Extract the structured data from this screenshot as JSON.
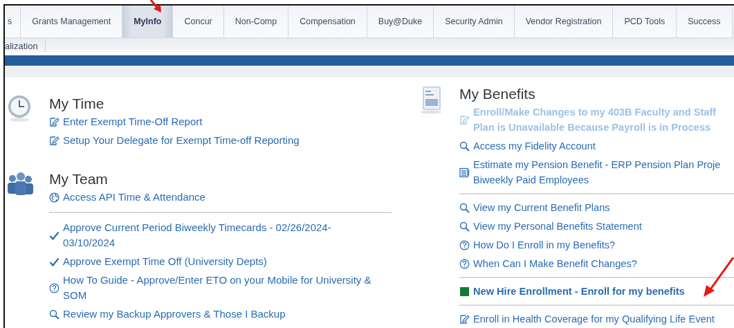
{
  "tabs": [
    {
      "label": "s",
      "selected": false
    },
    {
      "label": "Grants Management",
      "selected": false
    },
    {
      "label": "MyInfo",
      "selected": true
    },
    {
      "label": "Concur",
      "selected": false
    },
    {
      "label": "Non-Comp",
      "selected": false
    },
    {
      "label": "Compensation",
      "selected": false
    },
    {
      "label": "Buy@Duke",
      "selected": false
    },
    {
      "label": "Security Admin",
      "selected": false
    },
    {
      "label": "Vendor Registration",
      "selected": false
    },
    {
      "label": "PCD Tools",
      "selected": false
    },
    {
      "label": "Success",
      "selected": false
    }
  ],
  "subtabs": [
    {
      "label": "alization"
    }
  ],
  "columns": [
    {
      "sections": [
        {
          "title": "My Time",
          "kind": "clock",
          "groups": [
            [
              {
                "kind": "edit",
                "lines": [
                  "Enter Exempt Time-Off Report"
                ],
                "disabled": false,
                "bold": false
              },
              {
                "kind": "edit",
                "lines": [
                  "Setup Your Delegate for Exempt Time-off Reporting"
                ],
                "disabled": false,
                "bold": false
              }
            ]
          ]
        },
        {
          "title": "My Team",
          "kind": "team",
          "groups": [
            [
              {
                "kind": "globe",
                "lines": [
                  "Access API Time & Attendance"
                ],
                "disabled": false,
                "bold": false
              }
            ],
            [
              {
                "kind": "check",
                "lines": [
                  "Approve Current Period Biweekly Timecards - 02/26/2024-",
                  "03/10/2024"
                ],
                "disabled": false,
                "bold": false
              },
              {
                "kind": "check",
                "lines": [
                  "Approve Exempt Time Off (University Depts)"
                ],
                "disabled": false,
                "bold": false
              },
              {
                "kind": "help",
                "lines": [
                  "How To Guide - Approve/Enter ETO on your Mobile for University &",
                  "SOM"
                ],
                "disabled": false,
                "bold": false
              },
              {
                "kind": "search",
                "lines": [
                  "Review my Backup Approvers & Those I Backup"
                ],
                "disabled": false,
                "bold": false
              }
            ]
          ]
        }
      ]
    },
    {
      "sections": [
        {
          "title": "My Benefits",
          "kind": "document",
          "groups": [
            [
              {
                "kind": "edit",
                "lines": [
                  "Enroll/Make Changes to my 403B Faculty and Staff",
                  "Plan is Unavailable Because Payroll is in Process"
                ],
                "disabled": true,
                "bold": true
              },
              {
                "kind": "search",
                "lines": [
                  "Access my Fidelity Account"
                ],
                "disabled": false,
                "bold": false
              },
              {
                "kind": "list",
                "lines": [
                  "Estimate my Pension Benefit - ERP Pension Plan Proje",
                  "Biweekly Paid Employees"
                ],
                "disabled": false,
                "bold": false
              }
            ],
            [
              {
                "kind": "search",
                "lines": [
                  "View my Current Benefit Plans"
                ],
                "disabled": false,
                "bold": false
              },
              {
                "kind": "search",
                "lines": [
                  "View my Personal Benefits Statement"
                ],
                "disabled": false,
                "bold": false
              },
              {
                "kind": "help",
                "lines": [
                  "How Do I Enroll in my Benefits?"
                ],
                "disabled": false,
                "bold": false
              },
              {
                "kind": "help",
                "lines": [
                  "When Can I Make Benefit Changes?"
                ],
                "disabled": false,
                "bold": false
              }
            ],
            [
              {
                "kind": "square",
                "lines": [
                  "New Hire Enrollment - Enroll for my benefits"
                ],
                "disabled": false,
                "bold": true
              }
            ],
            [
              {
                "kind": "edit",
                "lines": [
                  "Enroll in Health Coverage for my Qualifying Life Event"
                ],
                "disabled": false,
                "bold": false
              }
            ]
          ]
        }
      ]
    }
  ]
}
